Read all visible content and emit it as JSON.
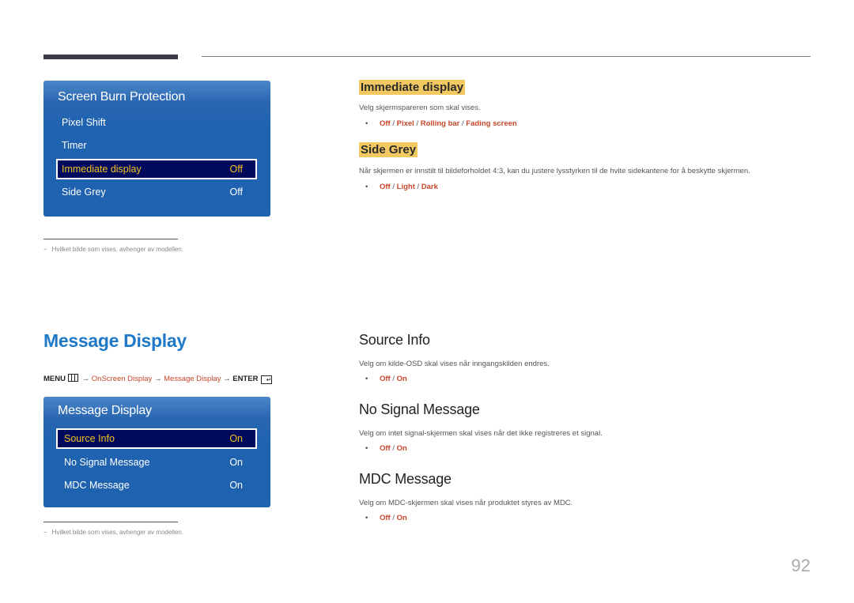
{
  "page_number": "92",
  "screen_burn_panel": {
    "title": "Screen Burn Protection",
    "rows": [
      {
        "label": "Pixel Shift",
        "value": ""
      },
      {
        "label": "Timer",
        "value": ""
      },
      {
        "label": "Immediate display",
        "value": "Off",
        "selected": true
      },
      {
        "label": "Side Grey",
        "value": "Off"
      }
    ]
  },
  "footnote_1": {
    "dash": "−",
    "text": "Hvilket bilde som vises, avhenger av modellen."
  },
  "immediate_display": {
    "heading": "Immediate display",
    "description": "Velg skjermspareren som skal vises.",
    "bullet": "•",
    "options": [
      "Off",
      "Pixel",
      "Rolling bar",
      "Fading screen"
    ]
  },
  "side_grey": {
    "heading": "Side Grey",
    "description": "Når skjermen er innstilt til bildeforholdet 4:3, kan du justere lysstyrken til de hvite sidekantene for å beskytte skjermen.",
    "bullet": "•",
    "options": [
      "Off",
      "Light",
      "Dark"
    ]
  },
  "message_display": {
    "title": "Message Display",
    "menu_path": {
      "menu": "MENU",
      "arrow": "→",
      "step1": "OnScreen Display",
      "step2": "Message Display",
      "enter": "ENTER",
      "menu_icon": "menu-grid-icon",
      "enter_icon": "enter-icon"
    },
    "panel": {
      "title": "Message Display",
      "rows": [
        {
          "label": "Source Info",
          "value": "On",
          "selected": true
        },
        {
          "label": "No Signal Message",
          "value": "On"
        },
        {
          "label": "MDC Message",
          "value": "On"
        }
      ]
    }
  },
  "footnote_2": {
    "dash": "−",
    "text": "Hvilket bilde som vises, avhenger av modellen."
  },
  "source_info": {
    "heading": "Source Info",
    "description": "Velg om kilde-OSD skal vises når inngangskilden endres.",
    "bullet": "•",
    "options": [
      "Off",
      "On"
    ]
  },
  "no_signal_message": {
    "heading": "No Signal Message",
    "description": "Velg om intet signal-skjermen skal vises når det ikke registreres et signal.",
    "bullet": "•",
    "options": [
      "Off",
      "On"
    ]
  },
  "mdc_message": {
    "heading": "MDC Message",
    "description": "Velg om MDC-skjermen skal vises når produktet styres av MDC.",
    "bullet": "•",
    "options": [
      "Off",
      "On"
    ]
  },
  "colors": {
    "osd_blue": "#1e62b0",
    "osd_selected_bg": "#000a5c",
    "osd_selected_text": "#f4c01e",
    "title_blue": "#1e78c8",
    "option_orange": "#c8452a",
    "heading_highlight": "#f2c860"
  }
}
